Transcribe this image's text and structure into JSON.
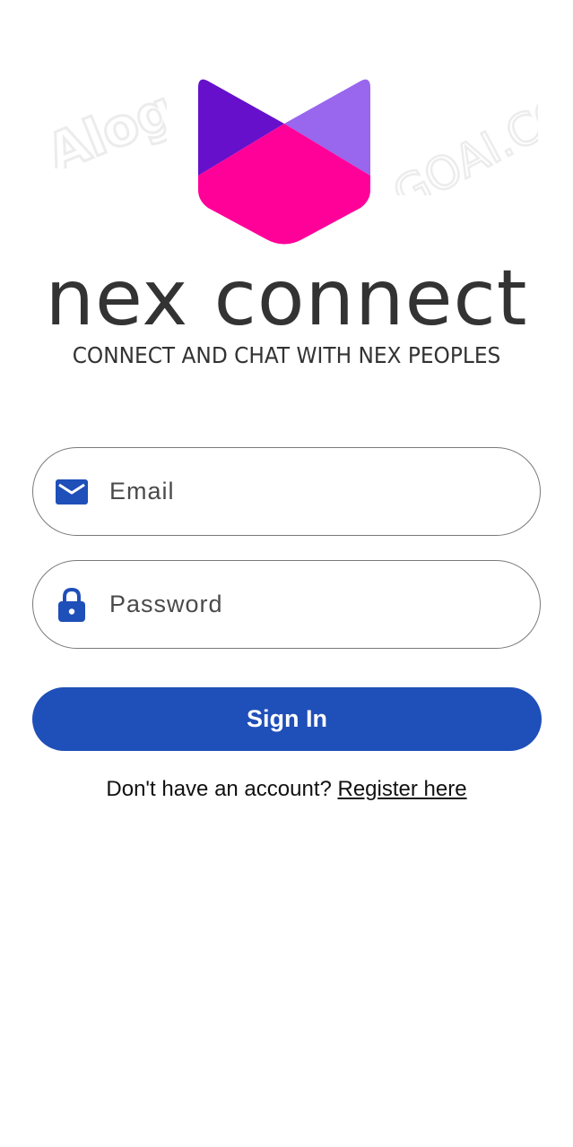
{
  "brand": {
    "name": "nex connect",
    "tagline": "CONNECT AND CHAT WITH NEX PEOPLES",
    "logo_colors": {
      "left_top": "#6610CC",
      "right_top": "#9966EE",
      "bottom": "#FF0099"
    },
    "watermark_left": "Alog",
    "watermark_right": "GOAI.CO"
  },
  "login_form": {
    "email": {
      "placeholder": "Email",
      "value": "",
      "icon": "mail-icon"
    },
    "password": {
      "placeholder": "Password",
      "value": "",
      "icon": "lock-icon"
    },
    "submit_label": "Sign In"
  },
  "register": {
    "prompt": "Don't have an account? ",
    "link_label": "Register here"
  },
  "colors": {
    "primary": "#1F4FB8",
    "text": "#333333",
    "field_border": "#7A7A7A",
    "background": "#FFFFFF"
  }
}
